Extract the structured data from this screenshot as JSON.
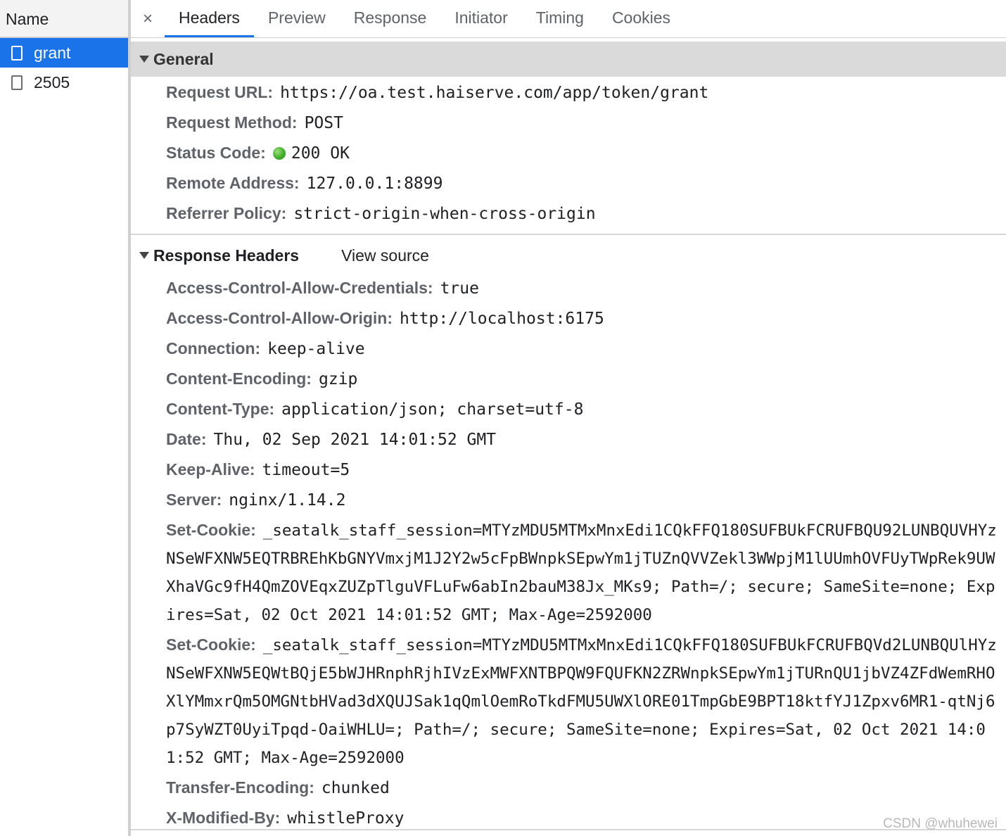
{
  "left_panel": {
    "header": "Name",
    "requests": [
      {
        "name": "grant",
        "selected": true
      },
      {
        "name": "2505",
        "selected": false
      }
    ]
  },
  "tabs": {
    "close_icon": "×",
    "items": [
      {
        "label": "Headers",
        "active": true
      },
      {
        "label": "Preview",
        "active": false
      },
      {
        "label": "Response",
        "active": false
      },
      {
        "label": "Initiator",
        "active": false
      },
      {
        "label": "Timing",
        "active": false
      },
      {
        "label": "Cookies",
        "active": false
      }
    ]
  },
  "general": {
    "title": "General",
    "rows": [
      {
        "key": "Request URL:",
        "value": "https://oa.test.haiserve.com/app/token/grant"
      },
      {
        "key": "Request Method:",
        "value": "POST"
      },
      {
        "key": "Status Code:",
        "value": "200 OK",
        "status_color": "#3fae2a"
      },
      {
        "key": "Remote Address:",
        "value": "127.0.0.1:8899"
      },
      {
        "key": "Referrer Policy:",
        "value": "strict-origin-when-cross-origin"
      }
    ]
  },
  "response_headers": {
    "title": "Response Headers",
    "view_source": "View source",
    "rows": [
      {
        "key": "Access-Control-Allow-Credentials:",
        "value": "true"
      },
      {
        "key": "Access-Control-Allow-Origin:",
        "value": "http://localhost:6175"
      },
      {
        "key": "Connection:",
        "value": "keep-alive"
      },
      {
        "key": "Content-Encoding:",
        "value": "gzip"
      },
      {
        "key": "Content-Type:",
        "value": "application/json; charset=utf-8"
      },
      {
        "key": "Date:",
        "value": "Thu, 02 Sep 2021 14:01:52 GMT"
      },
      {
        "key": "Keep-Alive:",
        "value": "timeout=5"
      },
      {
        "key": "Server:",
        "value": "nginx/1.14.2"
      },
      {
        "key": "Set-Cookie:",
        "value": "_seatalk_staff_session=MTYzMDU5MTMxMnxEdi1CQkFFQ180SUFBUkFCRUFBQU92LUNBQUVHYzNSeWFXNW5EQTRBREhKbGNYVmxjM1J2Y2w5cFpBWnpkSEpwYm1jTUZnQVVZekl3WWpjM1lUUmhOVFUyTWpRek9UWXhaVGc9fH4QmZOVEqxZUZpTlguVFLuFw6abIn2bauM38Jx_MKs9; Path=/; secure; SameSite=none; Expires=Sat, 02 Oct 2021 14:01:52 GMT; Max-Age=2592000",
        "long": true
      },
      {
        "key": "Set-Cookie:",
        "value": "_seatalk_staff_session=MTYzMDU5MTMxMnxEdi1CQkFFQ180SUFBUkFCRUFBQVd2LUNBQUlHYzNSeWFXNW5EQWtBQjE5bWJHRnphRjhIVzExMWFXNTBPQW9FQUFKN2ZRWnpkSEpwYm1jTURnQU1jbVZ4ZFdWemRHOXlYMmxrQm5OMGNtbHVad3dXQUJSak1qQmlOemRoTkdFMU5UWXlORE01TmpGbE9BPT18ktfYJ1Zpxv6MR1-qtNj6p7SyWZT0UyiTpqd-OaiWHLU=; Path=/; secure; SameSite=none; Expires=Sat, 02 Oct 2021 14:01:52 GMT; Max-Age=2592000",
        "long": true
      },
      {
        "key": "Transfer-Encoding:",
        "value": "chunked"
      },
      {
        "key": "X-Modified-By:",
        "value": "whistleProxy"
      }
    ]
  },
  "watermark": "CSDN @whuhewei"
}
